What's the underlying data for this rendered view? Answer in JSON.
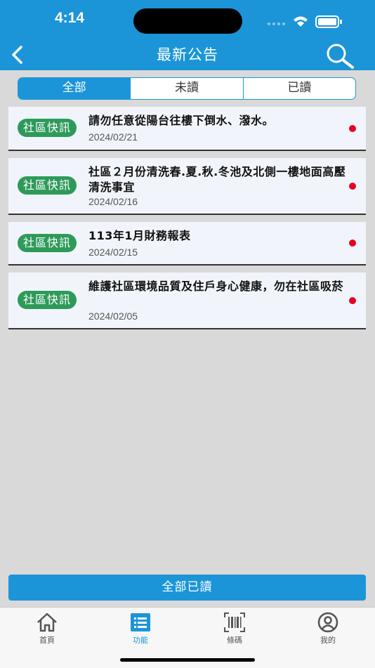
{
  "status_bar": {
    "time": "4:14"
  },
  "header": {
    "title": "最新公告"
  },
  "segments": [
    {
      "label": "全部"
    },
    {
      "label": "未讀"
    },
    {
      "label": "已讀"
    }
  ],
  "announcements": [
    {
      "badge": "社區快訊",
      "title": "請勿任意從陽台往樓下倒水、潑水。",
      "date": "2024/02/21",
      "unread": true
    },
    {
      "badge": "社區快訊",
      "title": "社區２月份清洗春.夏.秋.冬池及北側一樓地面高壓清洗事宜",
      "date": "2024/02/16",
      "unread": true
    },
    {
      "badge": "社區快訊",
      "title": "113年1月財務報表",
      "date": "2024/02/15",
      "unread": true
    },
    {
      "badge": "社區快訊",
      "title": "維護社區環境品質及住戶身心健康，勿在社區吸菸",
      "date": "2024/02/05",
      "unread": true
    }
  ],
  "mark_all_read_label": "全部已讀",
  "tabbar": [
    {
      "label": "首頁",
      "icon": "home-icon"
    },
    {
      "label": "功能",
      "icon": "list-icon"
    },
    {
      "label": "條碼",
      "icon": "barcode-icon"
    },
    {
      "label": "我的",
      "icon": "user-icon"
    }
  ],
  "colors": {
    "accent": "#1b95d8",
    "badge": "#2e9a5a",
    "unread_dot": "#e8001c"
  }
}
